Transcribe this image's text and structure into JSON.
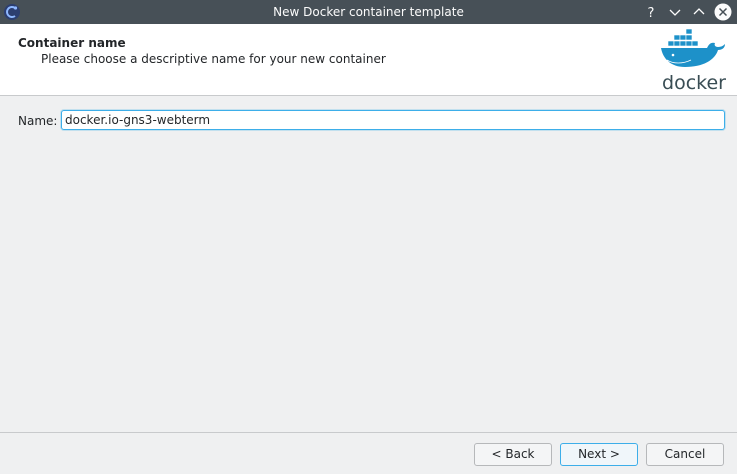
{
  "window": {
    "title": "New Docker container template"
  },
  "header": {
    "title": "Container name",
    "subtitle": "Please choose a descriptive name for your new container",
    "logo_text": "docker"
  },
  "form": {
    "name_label": "Name:",
    "name_value": "docker.io-gns3-webterm"
  },
  "buttons": {
    "back": "< Back",
    "next": "Next >",
    "cancel": "Cancel"
  },
  "colors": {
    "titlebar": "#475057",
    "focus_accent": "#3daee9",
    "docker_blue": "#1d91c9"
  },
  "icons": [
    "gns3-app-icon",
    "help-icon",
    "minimize-icon",
    "maximize-icon",
    "close-icon",
    "docker-whale-logo"
  ]
}
